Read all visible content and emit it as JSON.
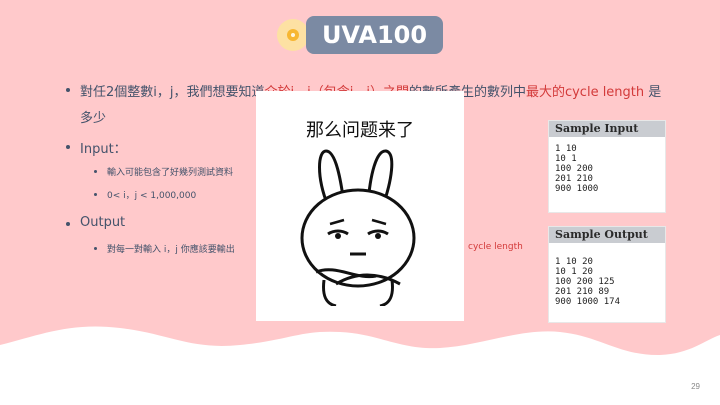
{
  "slide": {
    "title": "UVA100",
    "page_number": "29",
    "colors": {
      "background_pink": "#ffc9cb",
      "title_pill": "#7b8aa3",
      "accent_red": "#d33a3a",
      "body_text": "#44536b"
    }
  },
  "bullets": {
    "b1_pre": "對任2個整數i，j，我們想要知道",
    "b1_red1": "介於i，j（包含i，j）之間",
    "b1_mid": "的數所產生的數列中",
    "b1_red2": "最大的cycle length",
    "b1_post": " 是",
    "b1_line2": "多少",
    "input": "Input：",
    "input_sub1": "輸入可能包含了好幾列測試資料",
    "input_sub2": "0< i，j < 1,000,000",
    "output": "Output",
    "output_sub1_left": "對每一對輸入 i，j 你應該要輸出",
    "output_sub1_right": "cycle length"
  },
  "sample_input": {
    "header": "Sample Input",
    "lines": [
      "1 10",
      "10 1",
      "100 200",
      "201 210",
      "900 1000"
    ]
  },
  "sample_output": {
    "header": "Sample Output",
    "lines": [
      "1 10 20",
      "10 1 20",
      "100 200 125",
      "201 210 89",
      "900 1000 174"
    ]
  },
  "meme": {
    "caption": "那么问题来了",
    "icon": "rabbit-thinking-icon"
  }
}
